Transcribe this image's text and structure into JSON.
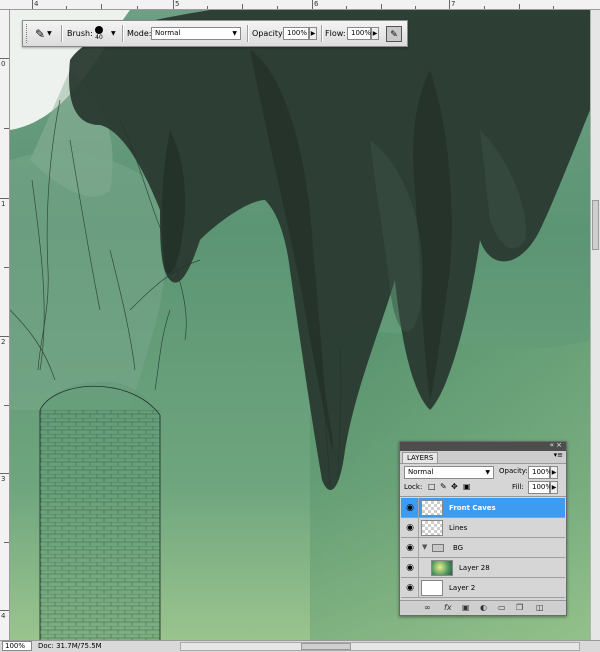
{
  "rulers": {
    "top_numbers": [
      "4",
      "5",
      "6",
      "7"
    ],
    "left_numbers": [
      "0",
      "1",
      "2",
      "3",
      "4"
    ]
  },
  "options_bar": {
    "brush_label": "Brush:",
    "brush_size": "40",
    "mode_label": "Mode:",
    "mode_value": "Normal",
    "opacity_label": "Opacity:",
    "opacity_value": "100%",
    "flow_label": "Flow:",
    "flow_value": "100%"
  },
  "layers_panel": {
    "tab_label": "LAYERS",
    "blend_mode": "Normal",
    "opacity_label": "Opacity:",
    "opacity_value": "100%",
    "lock_label": "Lock:",
    "fill_label": "Fill:",
    "fill_value": "100%",
    "layers": [
      {
        "name": "Front Caves",
        "selected": true
      },
      {
        "name": "Lines",
        "selected": false
      },
      {
        "name": "BG",
        "selected": false
      },
      {
        "name": "Layer 28",
        "selected": false
      },
      {
        "name": "Layer 2",
        "selected": false
      }
    ]
  },
  "status": {
    "zoom": "100%",
    "doc": "Doc: 31.7M/75.5M"
  },
  "colors": {
    "selection": "#3d9bf0",
    "canvas_green": "#5f9a74",
    "cave_dark": "#2a3a30"
  }
}
